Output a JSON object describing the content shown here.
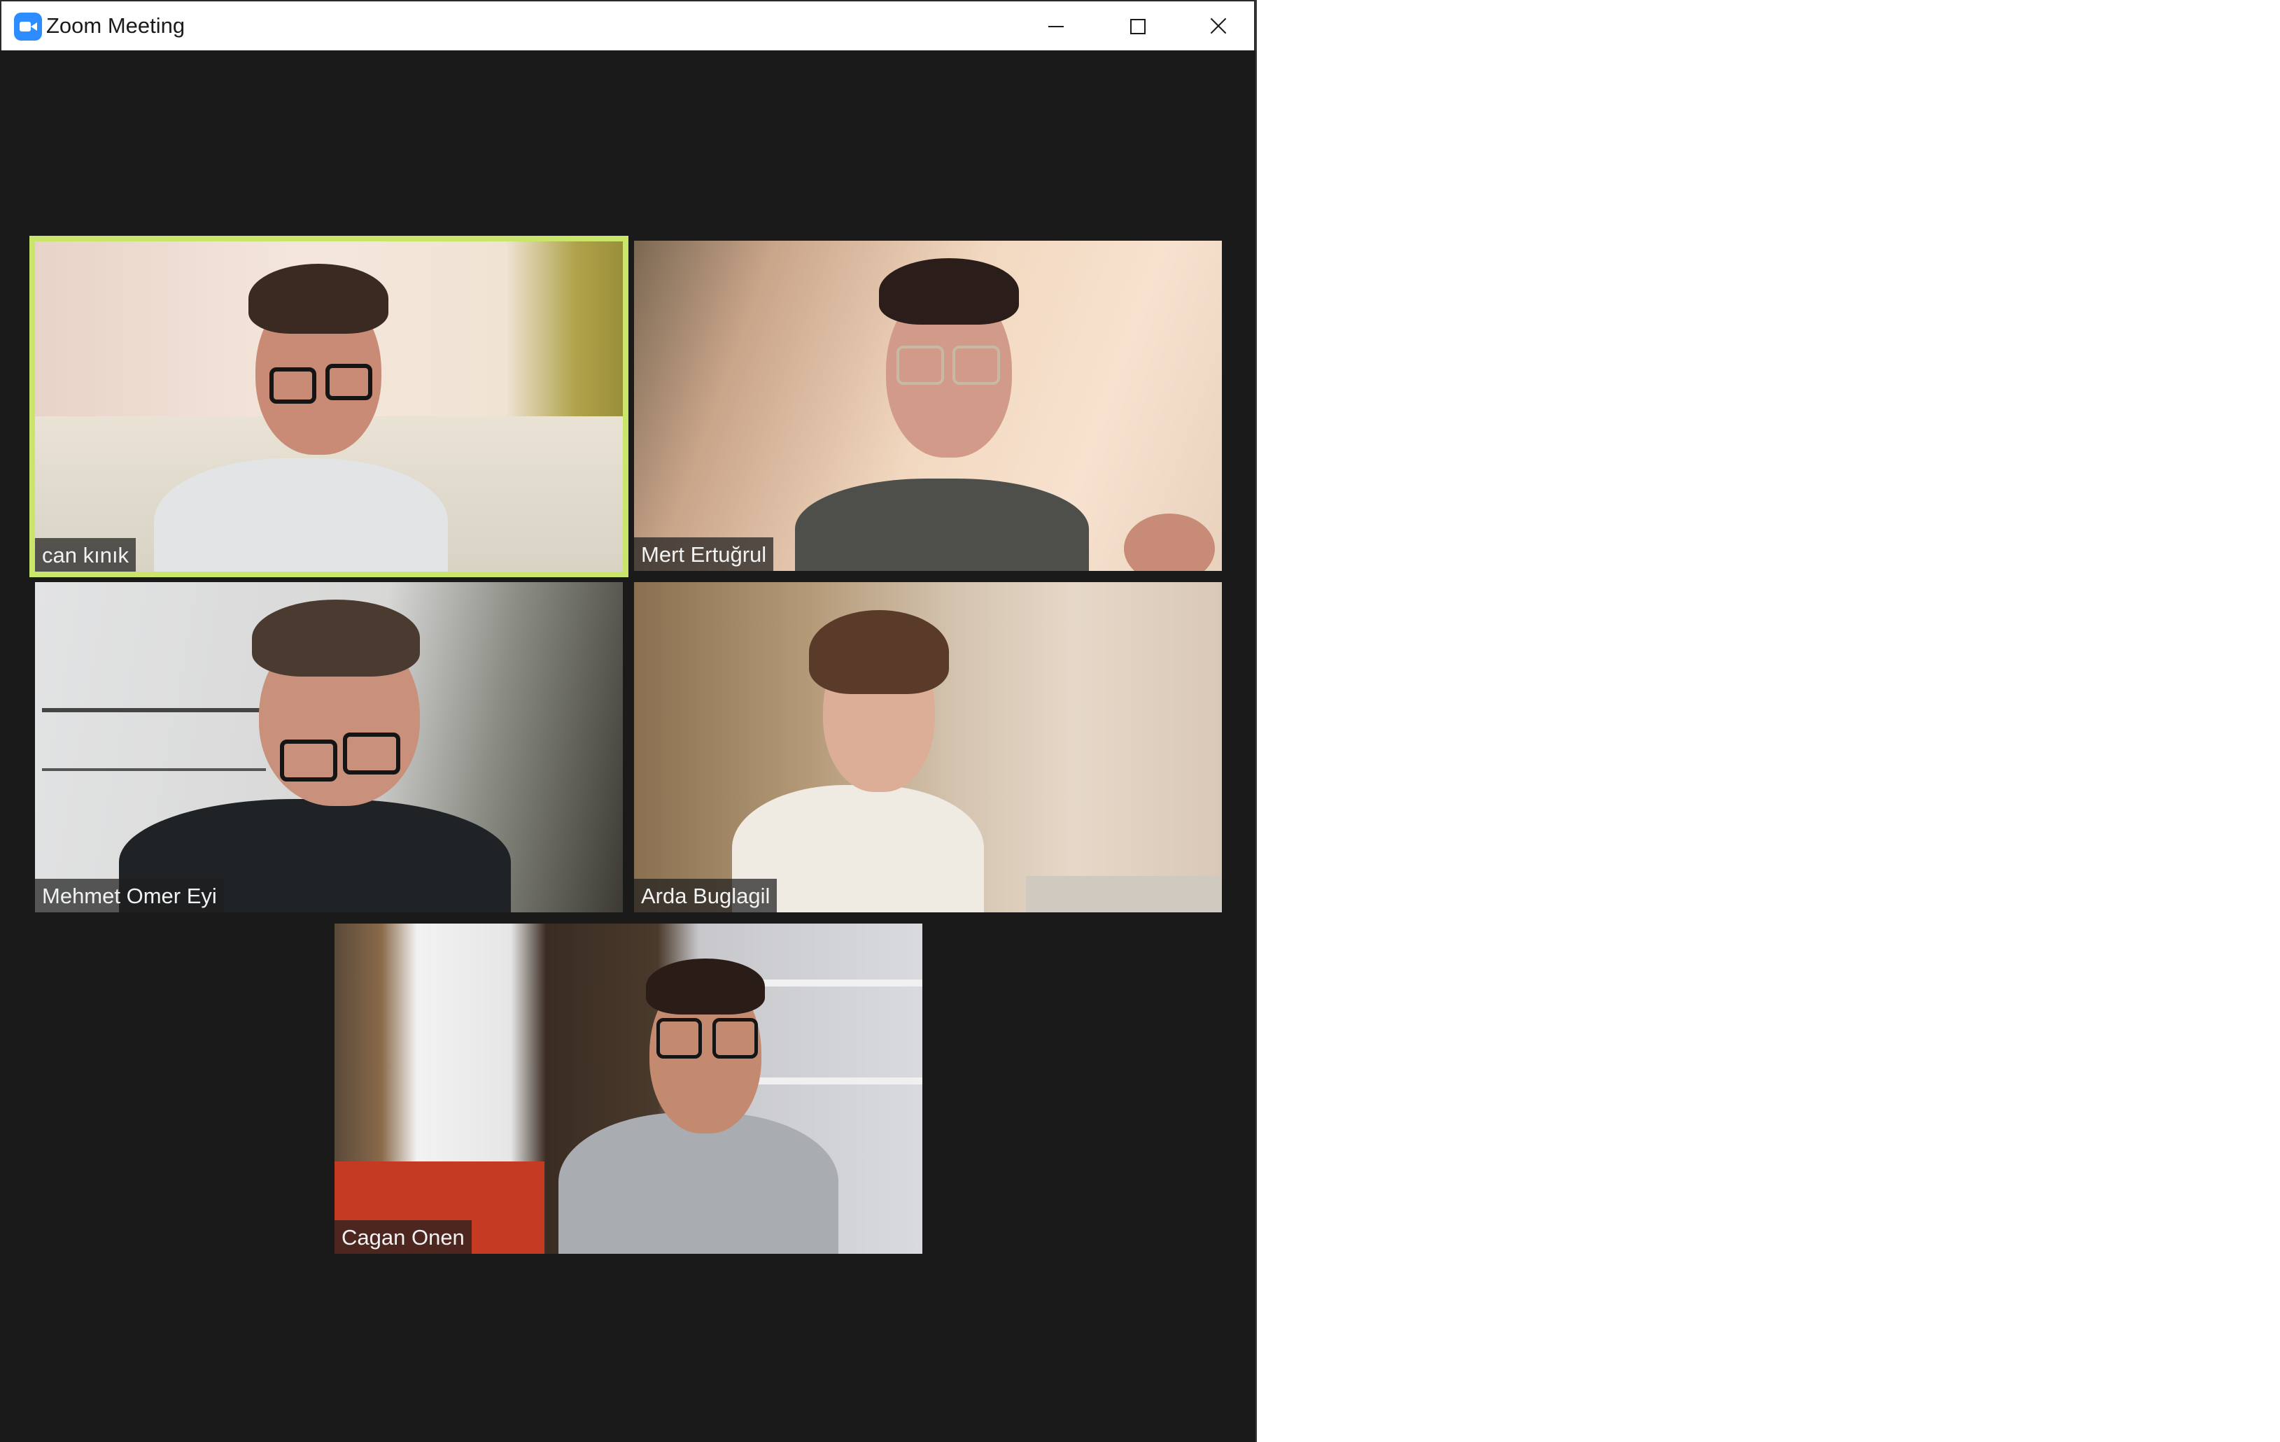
{
  "window": {
    "title": "Zoom Meeting",
    "accent": "#2d8cff",
    "controls": {
      "minimize": "minimize",
      "maximize": "maximize",
      "close": "close"
    }
  },
  "gallery": {
    "active_speaker_color": "#c9e56a",
    "participants": [
      {
        "name": "can kınık",
        "active_speaker": true
      },
      {
        "name": "Mert Ertuğrul",
        "active_speaker": false
      },
      {
        "name": "Mehmet Omer Eyi",
        "active_speaker": false
      },
      {
        "name": "Arda Buglagil",
        "active_speaker": false
      },
      {
        "name": "Cagan Onen",
        "active_speaker": false
      }
    ]
  }
}
